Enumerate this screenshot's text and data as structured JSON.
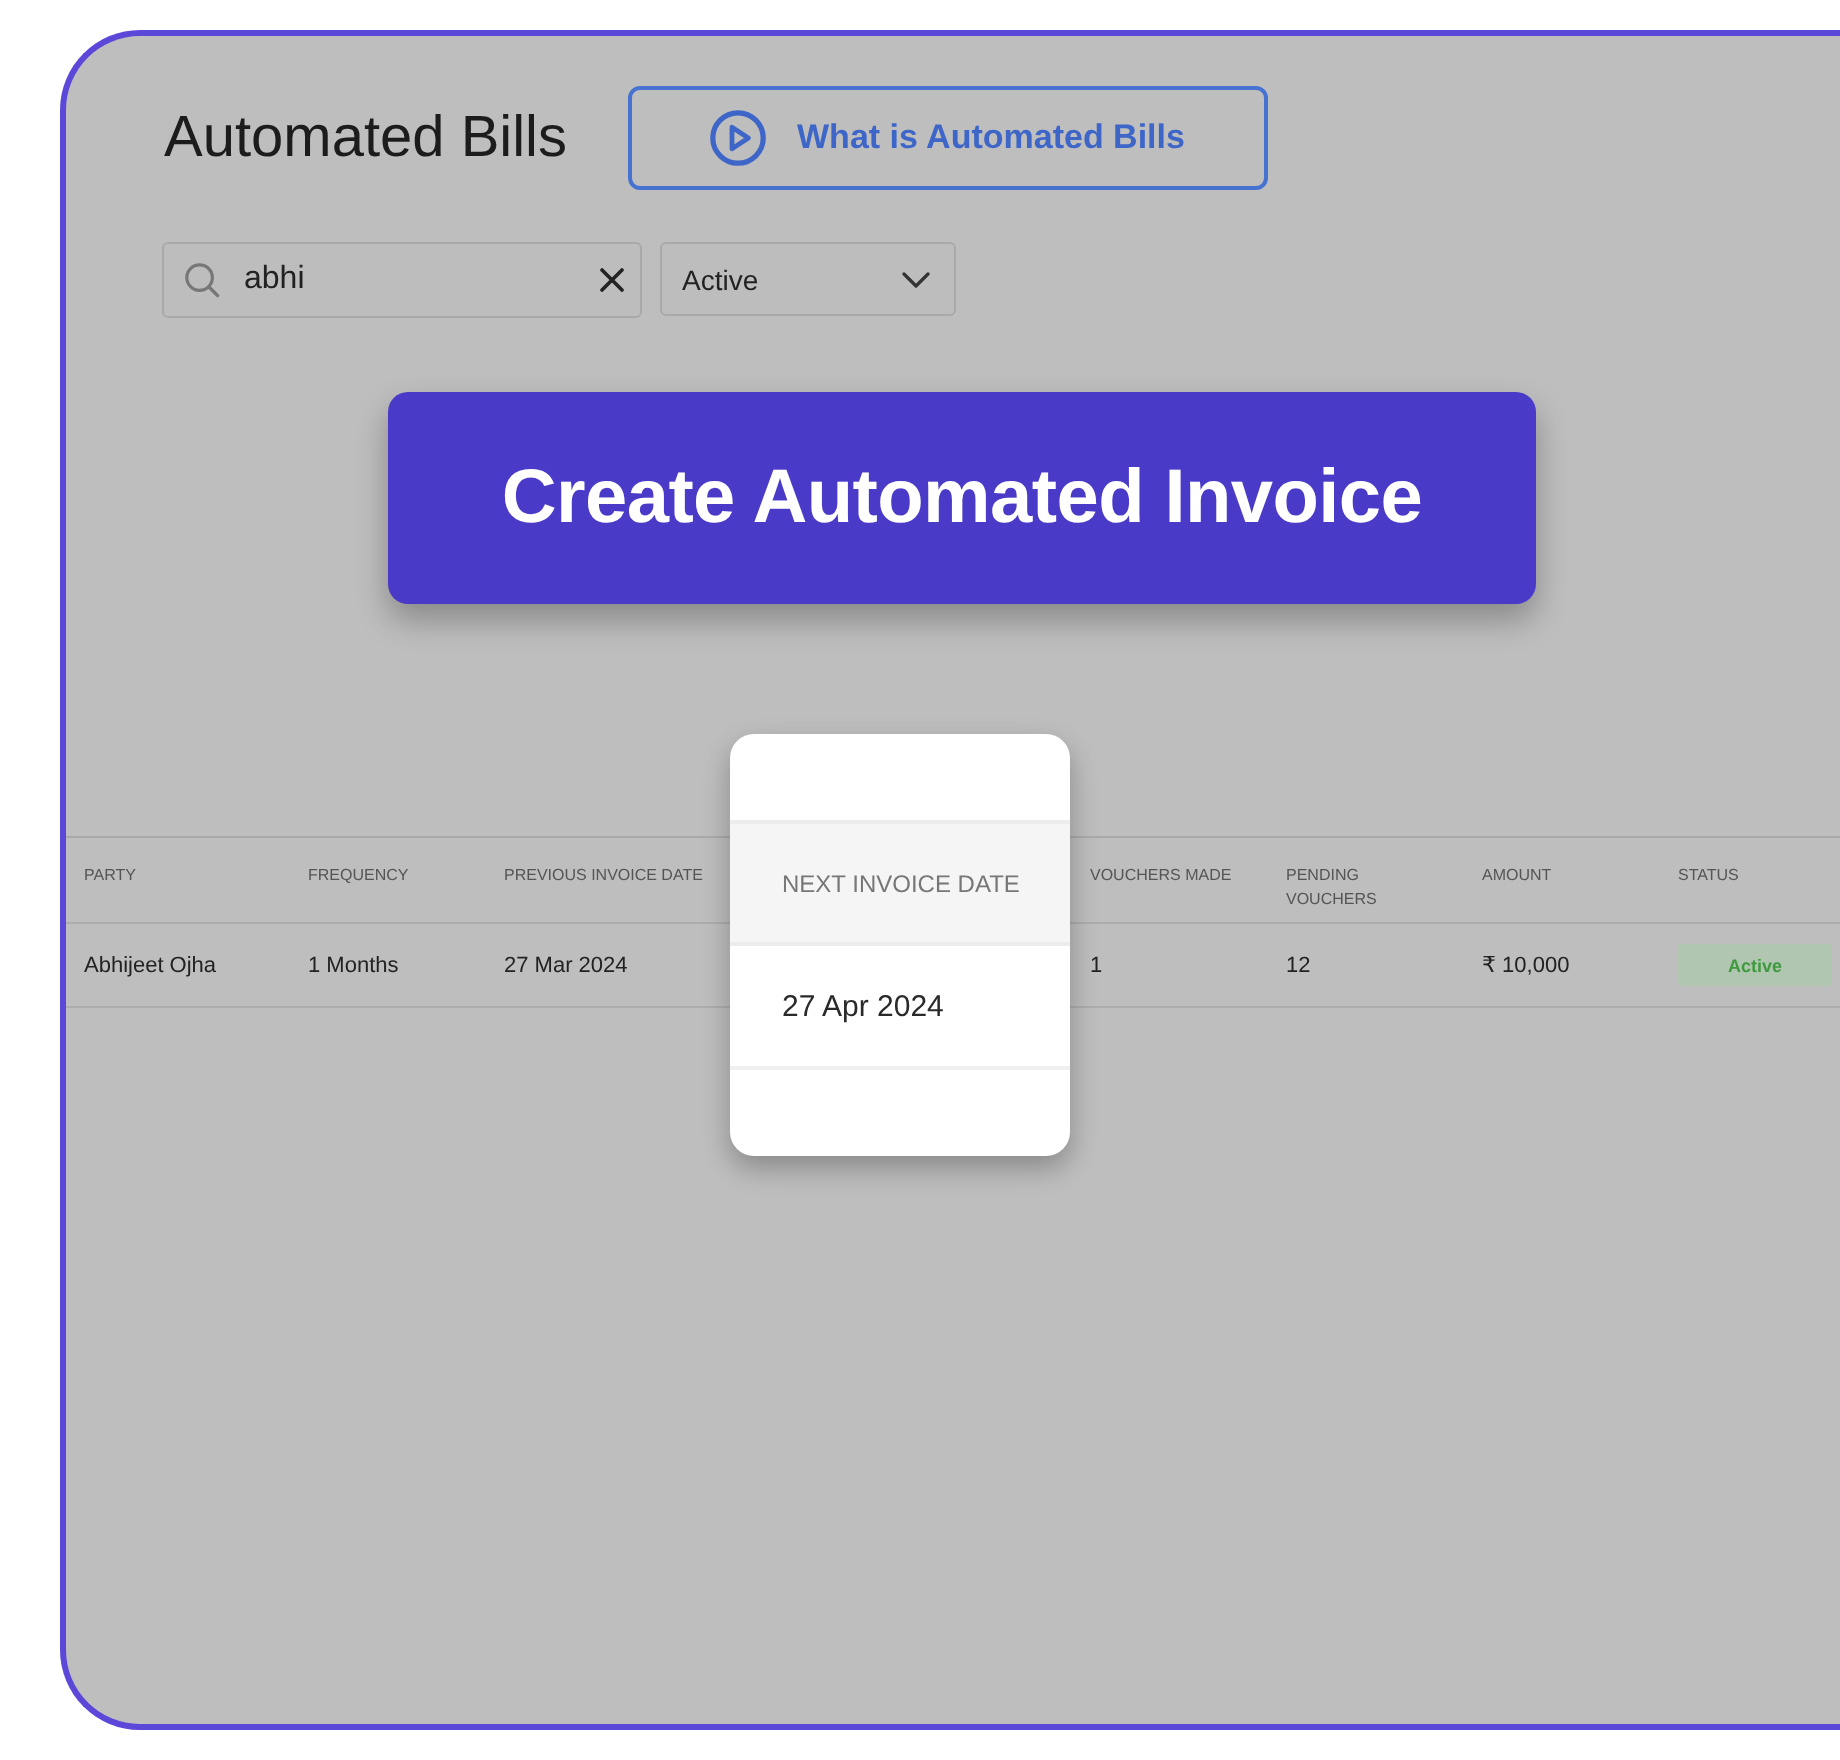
{
  "page": {
    "title": "Automated Bills",
    "help_button": "What is Automated Bills"
  },
  "filters": {
    "search": {
      "value": "abhi"
    },
    "status_dropdown": {
      "value": "Active"
    }
  },
  "create_button": "Create Automated Invoice",
  "table": {
    "columns": [
      {
        "label": "PARTY",
        "kind": "text",
        "highlighted": false
      },
      {
        "label": "FREQUENCY",
        "kind": "text",
        "highlighted": false
      },
      {
        "label": "PREVIOUS INVOICE DATE",
        "kind": "text",
        "highlighted": false
      },
      {
        "label": "NEXT INVOICE DATE",
        "kind": "text",
        "highlighted": true
      },
      {
        "label": "VOUCHERS MADE",
        "kind": "text",
        "highlighted": false
      },
      {
        "label": "PENDING VOUCHERS",
        "kind": "text",
        "highlighted": false
      },
      {
        "label": "AMOUNT",
        "kind": "text",
        "highlighted": false
      },
      {
        "label": "STATUS",
        "kind": "badge",
        "highlighted": false
      }
    ],
    "rows": [
      {
        "cells": [
          "Abhijeet Ojha",
          "1 Months",
          "27 Mar 2024",
          "27 Apr 2024",
          "1",
          "12",
          "₹ 10,000",
          "Active"
        ]
      }
    ]
  }
}
